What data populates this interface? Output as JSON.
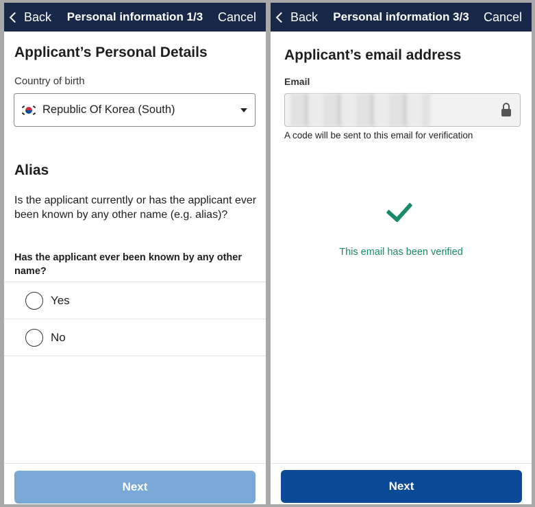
{
  "screens": [
    {
      "nav": {
        "back": "Back",
        "title": "Personal information 1/3",
        "cancel": "Cancel"
      },
      "heading": "Applicant’s Personal Details",
      "country": {
        "label": "Country of birth",
        "value": "Republic Of Korea (South)",
        "flag_icon": "south-korea-flag-icon"
      },
      "alias": {
        "heading": "Alias",
        "description": "Is the applicant currently or has the applicant ever been known by any other name (e.g. alias)?",
        "question": "Has the applicant ever been known by any other name?",
        "options": [
          "Yes",
          "No"
        ],
        "selected": null
      },
      "next": {
        "label": "Next",
        "enabled": false
      }
    },
    {
      "nav": {
        "back": "Back",
        "title": "Personal information 3/3",
        "cancel": "Cancel"
      },
      "heading": "Applicant’s email address",
      "email": {
        "label": "Email",
        "value": "",
        "locked": true,
        "hint": "A code will be sent to this email for verification"
      },
      "verified_text": "This email has been verified",
      "next": {
        "label": "Next",
        "enabled": true
      }
    }
  ],
  "colors": {
    "navbar": "#172849",
    "primary_button": "#0b4a97",
    "disabled_button": "#7aa8d6",
    "success": "#1a8a6a",
    "frame": "#a9a9a9"
  }
}
